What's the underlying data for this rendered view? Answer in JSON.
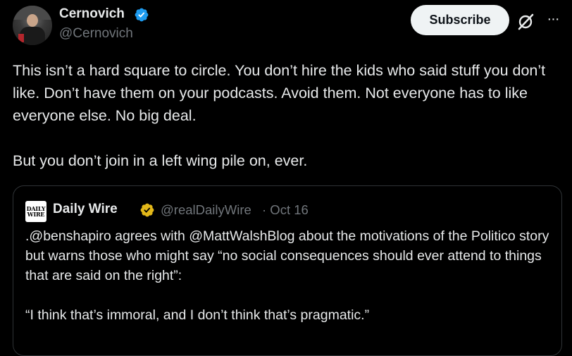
{
  "author": {
    "display_name": "Cernovich",
    "handle": "@Cernovich"
  },
  "actions": {
    "subscribe_label": "Subscribe",
    "grok_icon": "grok-icon",
    "more_label": "···"
  },
  "tweet": {
    "paragraphs": [
      "This isn’t a hard square to circle. You don’t hire the kids who said stuff you don’t like. Don’t have them on your podcasts. Avoid them. Not everyone has to like everyone else. No big deal.",
      "But you don’t join in a left wing pile on, ever."
    ]
  },
  "quote": {
    "logo_line1": "DAILY",
    "logo_line2": "WIRE",
    "display_name": "Daily Wire",
    "handle": "@realDailyWire",
    "date": "· Oct 16",
    "paragraphs": [
      ".@benshapiro agrees with @MattWalshBlog about the motivations of the Politico story but warns those who might say “no social consequences should ever attend to things that are said on the right”:",
      "“I think that’s immoral, and I don’t think that’s pragmatic.”"
    ]
  },
  "colors": {
    "background": "#000000",
    "text_primary": "#e7e9ea",
    "text_secondary": "#71767b",
    "verified_blue": "#1d9bf0",
    "verified_gold": "#e2b719",
    "border": "#2f3336",
    "button_bg": "#eff3f4"
  }
}
